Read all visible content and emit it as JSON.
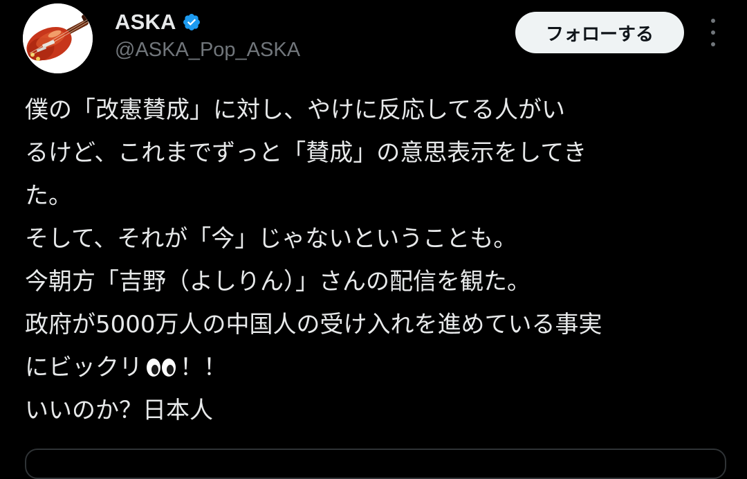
{
  "user": {
    "display_name": "ASKA",
    "handle": "@ASKA_Pop_ASKA",
    "verified": true,
    "avatar_icon": "violin-bass-guitar-icon",
    "verified_icon": "verified-badge-icon"
  },
  "actions": {
    "follow_label": "フォローする",
    "more_icon": "more-vertical-icon"
  },
  "tweet": {
    "lines": [
      "僕の「改憲賛成」に対し、やけに反応してる人がい",
      "るけど、これまでずっと「賛成」の意思表示をしてき",
      "た。",
      "そして、それが「今」じゃないということも。",
      "今朝方「吉野（よしりん）」さんの配信を観た。",
      "政府が5000万人の中国人の受け入れを進めている事実",
      "にビックリ",
      "いいのか？日本人"
    ],
    "emoji_after_line_7": "eyes-emoji-icon",
    "line_7_suffix": "！！"
  },
  "colors": {
    "background": "#000000",
    "text_primary": "#e7e9ea",
    "text_secondary": "#71767b",
    "verified_blue": "#1d9bf0",
    "follow_button_bg": "#eff3f4",
    "follow_button_text": "#0f1419"
  }
}
